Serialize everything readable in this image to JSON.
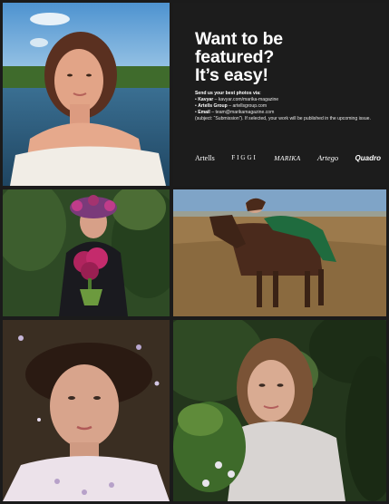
{
  "headline": {
    "line1": "Want to be",
    "line2": "featured?",
    "line3": "It’s easy!"
  },
  "info": {
    "lead": "Send us your best photos via:",
    "items": [
      {
        "bullet": "•",
        "label": "Kavyar",
        "text": " – kavyar.com/marika-magazine"
      },
      {
        "bullet": "•",
        "label": "Artells Group",
        "text": " – artellsgroup.com"
      },
      {
        "bullet": "•",
        "label": "Email",
        "text": " – team@marikamagazine.com"
      }
    ],
    "note": "(subject: “Submission”). If selected, your work will be published in the upcoming issue."
  },
  "logos": [
    "Artells",
    "FIGGI",
    "MARIKA",
    "Artego",
    "Quadro"
  ],
  "colors": {
    "panel_bg": "#1c1c1c",
    "page_bg": "#1b1b1b",
    "text": "#ffffff"
  }
}
